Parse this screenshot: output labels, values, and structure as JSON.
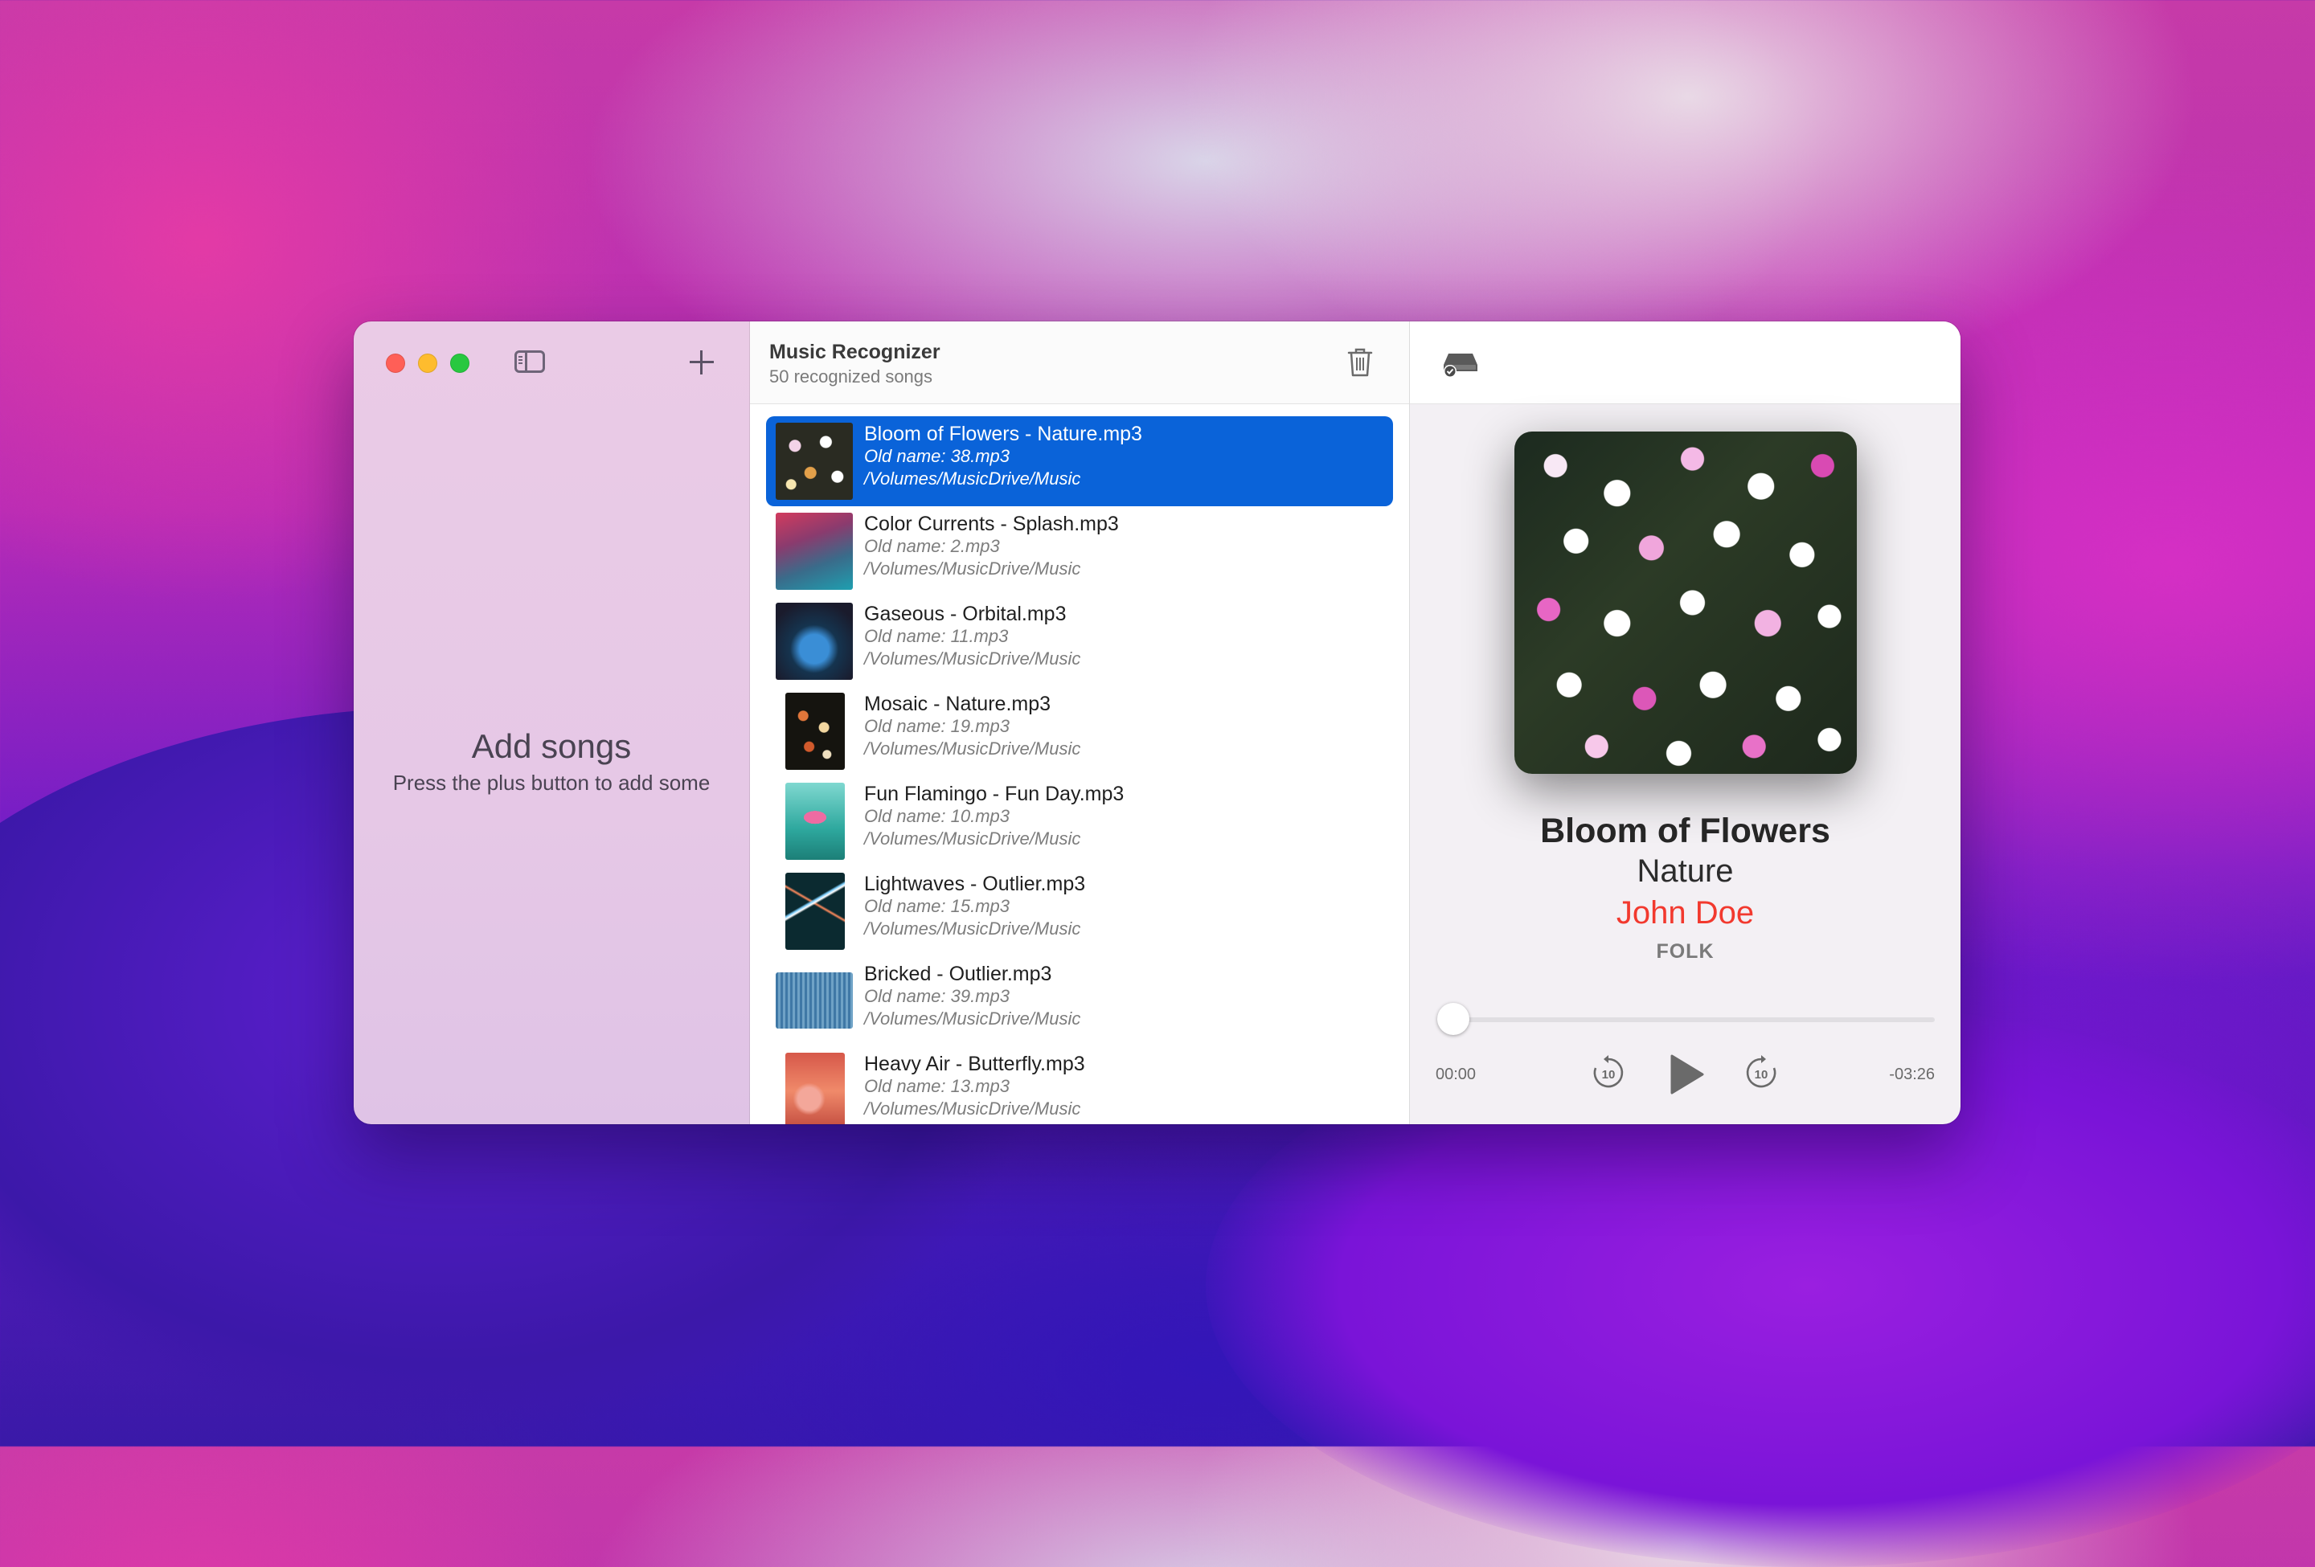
{
  "sidebar": {
    "empty_title": "Add songs",
    "empty_subtitle": "Press the plus button to add some"
  },
  "header": {
    "title": "Music Recognizer",
    "subtitle": "50 recognized songs"
  },
  "songs": [
    {
      "title": "Bloom of Flowers - Nature.mp3",
      "old": "Old name: 38.mp3",
      "path": "/Volumes/MusicDrive/Music",
      "selected": true
    },
    {
      "title": "Color Currents - Splash.mp3",
      "old": "Old name: 2.mp3",
      "path": "/Volumes/MusicDrive/Music"
    },
    {
      "title": "Gaseous - Orbital.mp3",
      "old": "Old name: 11.mp3",
      "path": "/Volumes/MusicDrive/Music"
    },
    {
      "title": "Mosaic - Nature.mp3",
      "old": "Old name: 19.mp3",
      "path": "/Volumes/MusicDrive/Music"
    },
    {
      "title": "Fun Flamingo - Fun Day.mp3",
      "old": "Old name: 10.mp3",
      "path": "/Volumes/MusicDrive/Music"
    },
    {
      "title": "Lightwaves - Outlier.mp3",
      "old": "Old name: 15.mp3",
      "path": "/Volumes/MusicDrive/Music"
    },
    {
      "title": "Bricked - Outlier.mp3",
      "old": "Old name: 39.mp3",
      "path": "/Volumes/MusicDrive/Music"
    },
    {
      "title": "Heavy Air - Butterfly.mp3",
      "old": "Old name: 13.mp3",
      "path": "/Volumes/MusicDrive/Music"
    }
  ],
  "player": {
    "title": "Bloom of Flowers",
    "album": "Nature",
    "artist": "John Doe",
    "genre": "FOLK",
    "elapsed": "00:00",
    "remaining": "-03:26",
    "progress": 0,
    "skip_back_seconds": "10",
    "skip_forward_seconds": "10"
  },
  "colors": {
    "selection": "#0a63d9",
    "artist": "#f2392e"
  },
  "icons": [
    "sidebar-toggle-icon",
    "plus-icon",
    "trash-icon",
    "external-drive-icon",
    "skip-back-10-icon",
    "play-icon",
    "skip-forward-10-icon"
  ]
}
